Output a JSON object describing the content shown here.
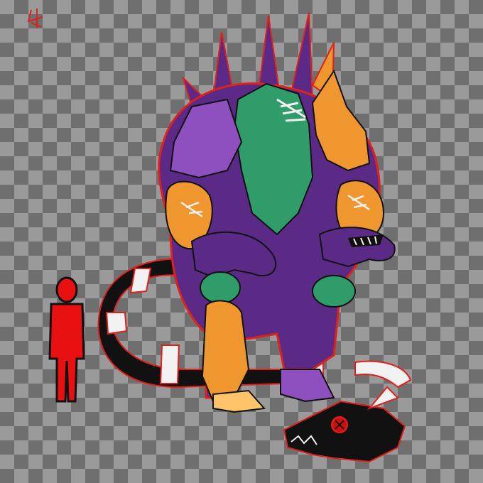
{
  "canvas": {
    "checker_light": "#9a9a9a",
    "checker_dark": "#6f6f6f"
  },
  "palette": {
    "purple": "#5b2a86",
    "purple_dark": "#2e0f4d",
    "purple_light": "#8e4fbf",
    "green": "#2f9c6a",
    "green_light": "#5fd39a",
    "orange": "#f0962e",
    "orange_light": "#ffc46a",
    "red_outline": "#e0201a",
    "black": "#111111",
    "white": "#f2f2f2",
    "human_red": "#e81010"
  },
  "figures": {
    "signature": "artist-signature",
    "scale_human": "red-human-silhouette",
    "creature": "patchwork-chimera-monster",
    "tail_head": "black-dog-head-tail-tip"
  }
}
